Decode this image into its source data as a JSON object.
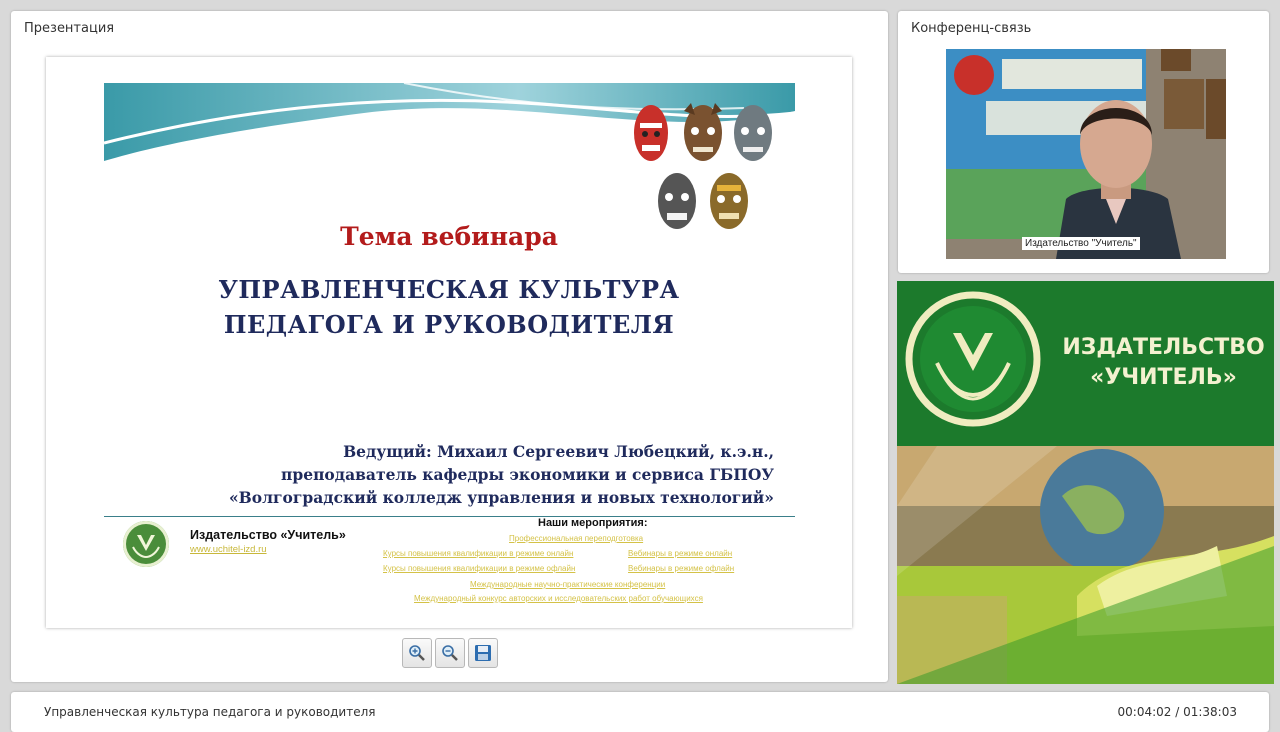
{
  "presentation": {
    "panel_title": "Презентация",
    "slide": {
      "topic": "Тема вебинара",
      "title_line1": "УПРАВЛЕНЧЕСКАЯ КУЛЬТУРА",
      "title_line2": "ПЕДАГОГА И РУКОВОДИТЕЛЯ",
      "presenter_line1": "Ведущий: Михаил Сергеевич Любецкий, к.э.н.,",
      "presenter_line2": "преподаватель кафедры экономики и сервиса ГБПОУ",
      "presenter_line3": "«Волгоградский колледж управления и новых технологий»",
      "publisher_name": "Издательство «Учитель»",
      "publisher_link": "www.uchitel-izd.ru",
      "events_heading": "Наши мероприятия:",
      "events": [
        "Профессиональная переподготовка",
        "Курсы повышения квалификации в режиме онлайн",
        "Вебинары в режиме онлайн",
        "Курсы повышения квалификации в режиме офлайн",
        "Вебинары в режиме офлайн",
        "Международные научно-практические конференции",
        "Международный конкурс авторских и исследовательских работ обучающихся"
      ]
    },
    "controls": {
      "zoom_in": "zoom-in-icon",
      "zoom_out": "zoom-out-icon",
      "save": "save-icon"
    }
  },
  "conference": {
    "panel_title": "Конференц-связь",
    "video_caption": "Издательство \"Учитель\""
  },
  "ad": {
    "line1": "ИЗДАТЕЛЬСТВО",
    "line2": "«УЧИТЕЛЬ»"
  },
  "footer": {
    "title": "Управленческая культура педагога и руководителя",
    "time": "00:04:02 / 01:38:03"
  },
  "colors": {
    "slide_red": "#b31b1b",
    "slide_navy": "#1f2a5c",
    "brand_green": "#1c7a2c"
  }
}
